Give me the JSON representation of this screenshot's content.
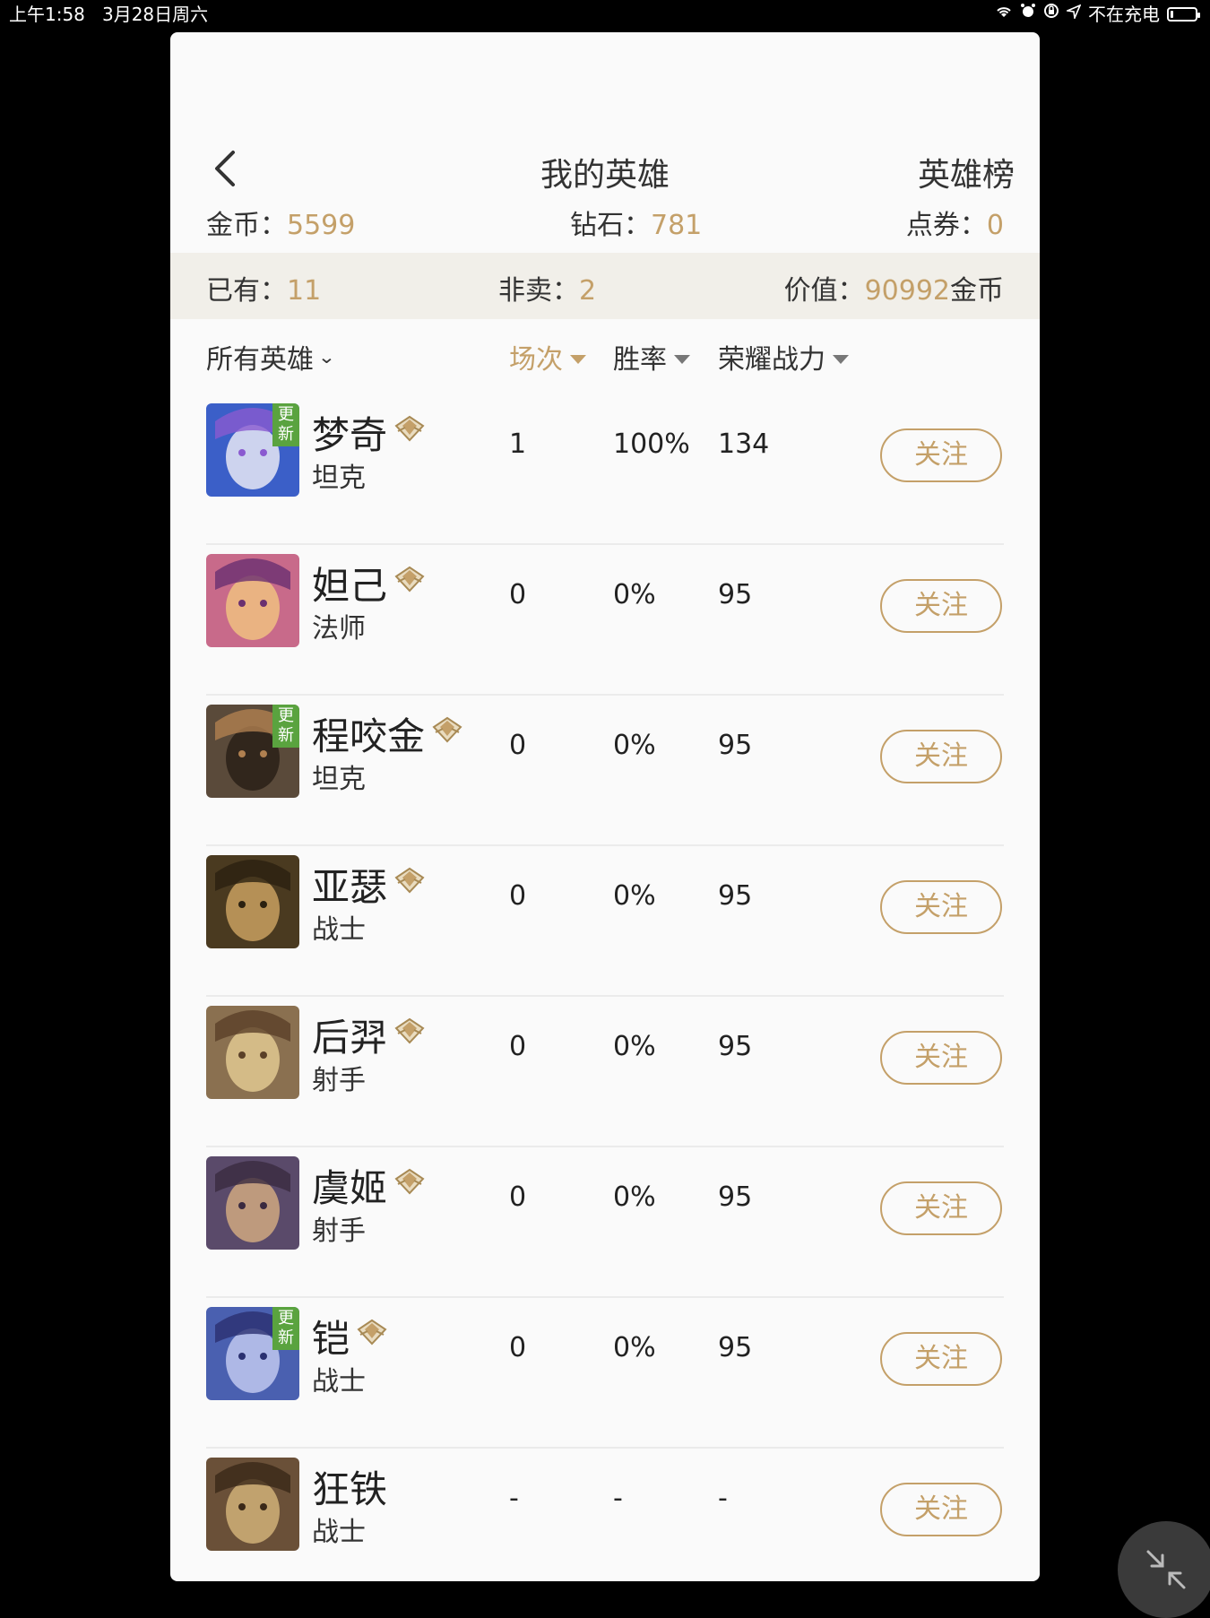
{
  "status_bar": {
    "left": "上午1:58   3月28日周六",
    "right": "不在充电",
    "battery_level": 0.12
  },
  "header": {
    "title": "我的英雄",
    "ranking": "英雄榜"
  },
  "currency": {
    "gold_label": "金币：",
    "gold_value": "5599",
    "diamond_label": "钻石：",
    "diamond_value": "781",
    "voucher_label": "点券：",
    "voucher_value": "0"
  },
  "stats": {
    "owned_label": "已有：",
    "owned_value": "11",
    "not_for_sale_label": "非卖：",
    "not_for_sale_value": "2",
    "worth_label": "价值：",
    "worth_value": "90992",
    "worth_unit": "金币"
  },
  "columns": {
    "filter": "所有英雄",
    "matches": "场次",
    "winrate": "胜率",
    "power": "荣耀战力"
  },
  "badge_text": "更新",
  "heroes": [
    {
      "name": "梦奇",
      "role": "坦克",
      "matches": "1",
      "winrate": "100%",
      "power": "134",
      "follow": "关注",
      "is_new": true,
      "has_mark": true
    },
    {
      "name": "妲己",
      "role": "法师",
      "matches": "0",
      "winrate": "0%",
      "power": "95",
      "follow": "关注",
      "is_new": false,
      "has_mark": true
    },
    {
      "name": "程咬金",
      "role": "坦克",
      "matches": "0",
      "winrate": "0%",
      "power": "95",
      "follow": "关注",
      "is_new": true,
      "has_mark": true
    },
    {
      "name": "亚瑟",
      "role": "战士",
      "matches": "0",
      "winrate": "0%",
      "power": "95",
      "follow": "关注",
      "is_new": false,
      "has_mark": true
    },
    {
      "name": "后羿",
      "role": "射手",
      "matches": "0",
      "winrate": "0%",
      "power": "95",
      "follow": "关注",
      "is_new": false,
      "has_mark": true
    },
    {
      "name": "虞姬",
      "role": "射手",
      "matches": "0",
      "winrate": "0%",
      "power": "95",
      "follow": "关注",
      "is_new": false,
      "has_mark": true
    },
    {
      "name": "铠",
      "role": "战士",
      "matches": "0",
      "winrate": "0%",
      "power": "95",
      "follow": "关注",
      "is_new": true,
      "has_mark": true
    },
    {
      "name": "狂铁",
      "role": "战士",
      "matches": "-",
      "winrate": "-",
      "power": "-",
      "follow": "关注",
      "is_new": false,
      "has_mark": false
    }
  ],
  "colors": {
    "accent": "#c4a069",
    "badge": "#5aa33f",
    "stats_bg": "#f1efe9"
  },
  "icons": {
    "back": "chevron-left-icon",
    "mark": "diamond-mark-icon",
    "fab": "collapse-arrows-icon",
    "wifi": "wifi-icon",
    "alarm": "alarm-icon",
    "location": "location-arrow-icon"
  }
}
